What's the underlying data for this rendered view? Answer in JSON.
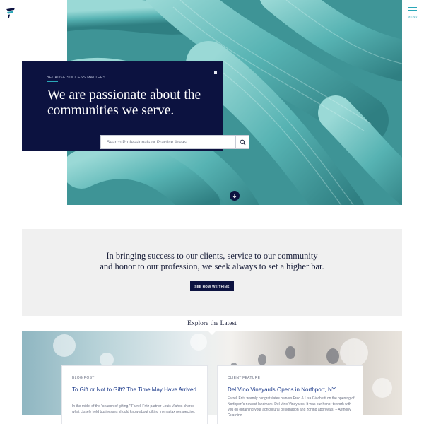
{
  "header": {
    "logo": "firm-logo",
    "menu_label": "MENU"
  },
  "hero": {
    "eyebrow": "BECAUSE SUCCESS MATTERS",
    "title": "We are passionate about the communities we serve.",
    "search_placeholder": "Search Professionals or Practice Areas",
    "icons": [
      "pause-icon",
      "search-icon",
      "arrow-down-icon"
    ]
  },
  "mission": {
    "line1": "In bringing success to our clients, service to our community",
    "line2": "and honor to our profession, we seek always to set a higher bar.",
    "button_label": "SEE HOW WE THINK"
  },
  "explore": {
    "title": "Explore the Latest",
    "cards": [
      {
        "category": "BLOG POST",
        "title": "To Gift or Not to Gift? The Time May Have Arrived",
        "excerpt": "In the midst of the \"season of gifting,\" Farrell Fritz partner Louis Vlahos shares what closely held businesses should know about gifting from a tax perspective."
      },
      {
        "category": "CLIENT FEATURE",
        "title": "Del Vino Vineyards Opens in Northport, NY",
        "excerpt": "Farrell Fritz warmly congratulates owners Fred & Lisa Giachetti on the opening of Northport's newest landmark, Del Vino Vineyards! It was our honor to work with you on obtaining your agricultural designation and zoning approvals. – Anthony Guardino"
      }
    ]
  },
  "colors": {
    "navy": "#0c1240",
    "teal": "#2aa7b8",
    "band": "#f0f0f0",
    "link": "#1c3a8a"
  }
}
